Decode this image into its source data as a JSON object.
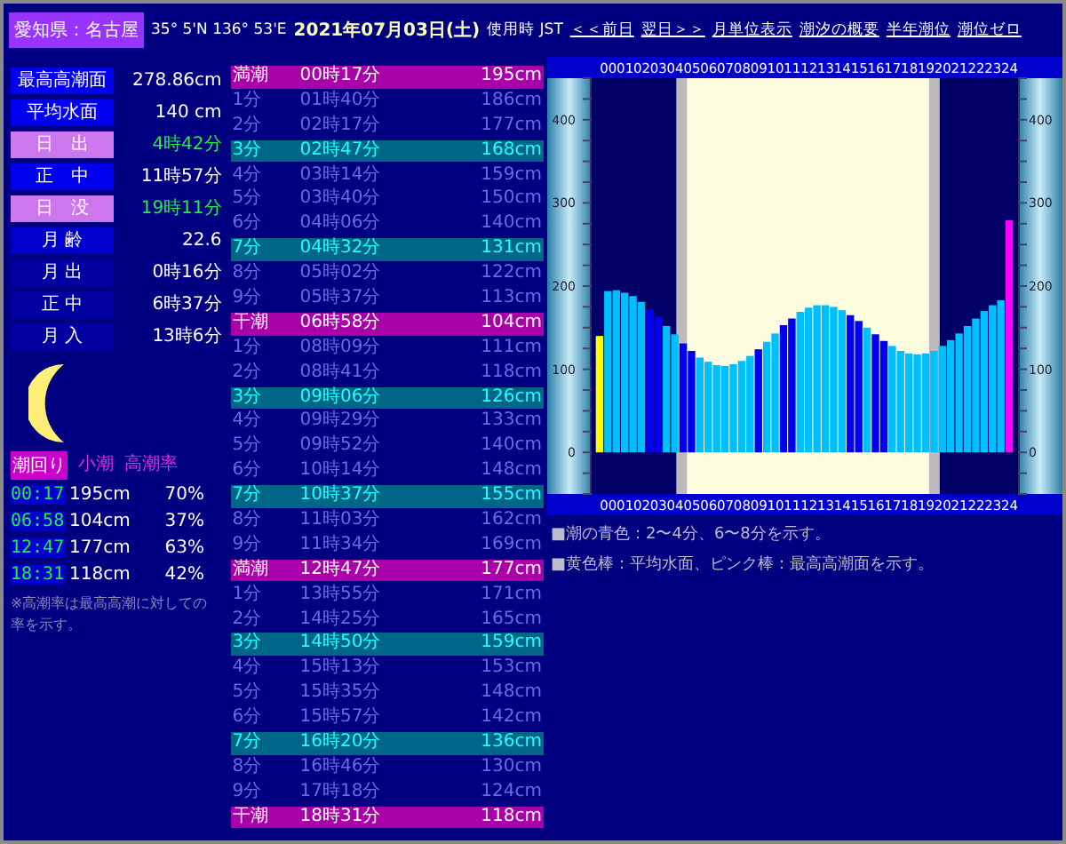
{
  "header": {
    "location": "愛知県：名古屋",
    "coords": "35° 5'N 136° 53'E",
    "date": "2021年07月03日(土)",
    "timezone": "使用時 JST",
    "links": [
      "＜＜前日",
      "翌日＞＞",
      "月単位表示",
      "潮汐の概要",
      "半年潮位",
      "潮位ゼロ"
    ]
  },
  "info": [
    {
      "kind": "tide",
      "label": "最高高潮面",
      "value": "278.86cm"
    },
    {
      "kind": "tide",
      "label": "平均水面",
      "value": "140 cm"
    },
    {
      "kind": "sun",
      "label": "日　出",
      "value": "4時42分"
    },
    {
      "kind": "tide",
      "label": "正　中",
      "value": "11時57分"
    },
    {
      "kind": "sun",
      "label": "日　没",
      "value": "19時11分"
    },
    {
      "kind": "age",
      "label": "月 齢",
      "value": "22.6"
    },
    {
      "kind": "moon",
      "label": "月 出",
      "value": "0時16分"
    },
    {
      "kind": "moon",
      "label": "正 中",
      "value": "6時37分"
    },
    {
      "kind": "moon",
      "label": "月 入",
      "value": "13時6分"
    }
  ],
  "summary": {
    "headers": [
      "潮回り",
      "小潮",
      "高潮率"
    ],
    "rows": [
      {
        "time": "00:17",
        "height": "195cm",
        "rate": "70%"
      },
      {
        "time": "06:58",
        "height": "104cm",
        "rate": "37%"
      },
      {
        "time": "12:47",
        "height": "177cm",
        "rate": "63%"
      },
      {
        "time": "18:31",
        "height": "118cm",
        "rate": "42%"
      }
    ],
    "note": "※高潮率は最高高潮に対しての率を示す。"
  },
  "tide_table": [
    {
      "kind": "peak",
      "label": "満潮",
      "time": "00時17分",
      "height": "195cm"
    },
    {
      "kind": "plain",
      "label": "1分",
      "time": "01時40分",
      "height": "186cm"
    },
    {
      "kind": "plain",
      "label": "2分",
      "time": "02時17分",
      "height": "177cm"
    },
    {
      "kind": "mark",
      "label": "3分",
      "time": "02時47分",
      "height": "168cm"
    },
    {
      "kind": "plain",
      "label": "4分",
      "time": "03時14分",
      "height": "159cm"
    },
    {
      "kind": "plain",
      "label": "5分",
      "time": "03時40分",
      "height": "150cm"
    },
    {
      "kind": "plain",
      "label": "6分",
      "time": "04時06分",
      "height": "140cm"
    },
    {
      "kind": "mark",
      "label": "7分",
      "time": "04時32分",
      "height": "131cm"
    },
    {
      "kind": "plain",
      "label": "8分",
      "time": "05時02分",
      "height": "122cm"
    },
    {
      "kind": "plain",
      "label": "9分",
      "time": "05時37分",
      "height": "113cm"
    },
    {
      "kind": "peak",
      "label": "干潮",
      "time": "06時58分",
      "height": "104cm"
    },
    {
      "kind": "plain",
      "label": "1分",
      "time": "08時09分",
      "height": "111cm"
    },
    {
      "kind": "plain",
      "label": "2分",
      "time": "08時41分",
      "height": "118cm"
    },
    {
      "kind": "mark",
      "label": "3分",
      "time": "09時06分",
      "height": "126cm"
    },
    {
      "kind": "plain",
      "label": "4分",
      "time": "09時29分",
      "height": "133cm"
    },
    {
      "kind": "plain",
      "label": "5分",
      "time": "09時52分",
      "height": "140cm"
    },
    {
      "kind": "plain",
      "label": "6分",
      "time": "10時14分",
      "height": "148cm"
    },
    {
      "kind": "mark",
      "label": "7分",
      "time": "10時37分",
      "height": "155cm"
    },
    {
      "kind": "plain",
      "label": "8分",
      "time": "11時03分",
      "height": "162cm"
    },
    {
      "kind": "plain",
      "label": "9分",
      "time": "11時34分",
      "height": "169cm"
    },
    {
      "kind": "peak",
      "label": "満潮",
      "time": "12時47分",
      "height": "177cm"
    },
    {
      "kind": "plain",
      "label": "1分",
      "time": "13時55分",
      "height": "171cm"
    },
    {
      "kind": "plain",
      "label": "2分",
      "time": "14時25分",
      "height": "165cm"
    },
    {
      "kind": "mark",
      "label": "3分",
      "time": "14時50分",
      "height": "159cm"
    },
    {
      "kind": "plain",
      "label": "4分",
      "time": "15時13分",
      "height": "153cm"
    },
    {
      "kind": "plain",
      "label": "5分",
      "time": "15時35分",
      "height": "148cm"
    },
    {
      "kind": "plain",
      "label": "6分",
      "time": "15時57分",
      "height": "142cm"
    },
    {
      "kind": "mark",
      "label": "7分",
      "time": "16時20分",
      "height": "136cm"
    },
    {
      "kind": "plain",
      "label": "8分",
      "time": "16時46分",
      "height": "130cm"
    },
    {
      "kind": "plain",
      "label": "9分",
      "time": "17時18分",
      "height": "124cm"
    },
    {
      "kind": "peak",
      "label": "干潮",
      "time": "18時31分",
      "height": "118cm"
    }
  ],
  "graph": {
    "chart_data": {
      "type": "bar",
      "ylim": [
        -50,
        450
      ],
      "yticks": [
        0,
        100,
        200,
        300,
        400
      ],
      "xlim": [
        -1,
        24.5
      ],
      "xticks": [
        {
          "value": 0,
          "label": "00"
        },
        {
          "value": 1,
          "label": "01"
        },
        {
          "value": 2,
          "label": "02"
        },
        {
          "value": 3,
          "label": "03"
        },
        {
          "value": 4,
          "label": "04"
        },
        {
          "value": 5,
          "label": "05"
        },
        {
          "value": 6,
          "label": "06"
        },
        {
          "value": 7,
          "label": "07"
        },
        {
          "value": 8,
          "label": "08"
        },
        {
          "value": 9,
          "label": "09"
        },
        {
          "value": 10,
          "label": "10"
        },
        {
          "value": 11,
          "label": "11"
        },
        {
          "value": 12,
          "label": "12"
        },
        {
          "value": 13,
          "label": "13"
        },
        {
          "value": 14,
          "label": "14"
        },
        {
          "value": 15,
          "label": "15"
        },
        {
          "value": 16,
          "label": "16"
        },
        {
          "value": 17,
          "label": "17"
        },
        {
          "value": 18,
          "label": "18"
        },
        {
          "value": 19,
          "label": "19"
        },
        {
          "value": 20,
          "label": "20"
        },
        {
          "value": 21,
          "label": "21"
        },
        {
          "value": 22,
          "label": "22"
        },
        {
          "value": 23,
          "label": "23"
        },
        {
          "value": 24,
          "label": "24"
        }
      ],
      "x": [
        -0.5,
        0,
        0.5,
        1,
        1.5,
        2,
        2.5,
        3,
        3.5,
        4,
        4.5,
        5,
        5.5,
        6,
        6.5,
        7,
        7.5,
        8,
        8.5,
        9,
        9.5,
        10,
        10.5,
        11,
        11.5,
        12,
        12.5,
        13,
        13.5,
        14,
        14.5,
        15,
        15.5,
        16,
        16.5,
        17,
        17.5,
        18,
        18.5,
        19,
        19.5,
        20,
        20.5,
        21,
        21.5,
        22,
        22.5,
        23,
        23.5,
        24
      ],
      "series": [
        {
          "color": "#ffff00",
          "values": [
            140,
            null,
            null,
            null,
            null,
            null,
            null,
            null,
            null,
            null,
            null,
            null,
            null,
            null,
            null,
            null,
            null,
            null,
            null,
            null,
            null,
            null,
            null,
            null,
            null,
            null,
            null,
            null,
            null,
            null,
            null,
            null,
            null,
            null,
            null,
            null,
            null,
            null,
            null,
            null,
            null,
            null,
            null,
            null,
            null,
            null,
            null,
            null,
            null,
            null
          ]
        },
        {
          "color": "#00bfff",
          "values": [
            null,
            194,
            195,
            192,
            188,
            181,
            null,
            null,
            152,
            142,
            null,
            null,
            114,
            109,
            105,
            104,
            106,
            110,
            116,
            null,
            133,
            143,
            null,
            null,
            169,
            174,
            177,
            177,
            175,
            171,
            null,
            null,
            150,
            null,
            null,
            128,
            122,
            119,
            118,
            119,
            122,
            128,
            135,
            143,
            152,
            161,
            170,
            177,
            183,
            null
          ]
        },
        {
          "color": "#0000ee",
          "values": [
            null,
            null,
            null,
            null,
            null,
            null,
            172,
            163,
            null,
            null,
            131,
            122,
            null,
            null,
            null,
            null,
            null,
            null,
            null,
            124,
            null,
            null,
            153,
            161,
            null,
            null,
            null,
            null,
            null,
            null,
            165,
            158,
            null,
            142,
            134,
            null,
            null,
            null,
            null,
            null,
            null,
            null,
            null,
            null,
            null,
            null,
            null,
            null,
            null,
            null
          ]
        },
        {
          "color": "#ff00ff",
          "values": [
            null,
            null,
            null,
            null,
            null,
            null,
            null,
            null,
            null,
            null,
            null,
            null,
            null,
            null,
            null,
            null,
            null,
            null,
            null,
            null,
            null,
            null,
            null,
            null,
            null,
            null,
            null,
            null,
            null,
            null,
            null,
            null,
            null,
            null,
            null,
            null,
            null,
            null,
            null,
            null,
            null,
            null,
            null,
            null,
            null,
            null,
            null,
            null,
            null,
            279
          ]
        }
      ]
    },
    "left_axis_labels": [
      "400",
      "300",
      "200",
      "100",
      "0"
    ],
    "notes": [
      "■潮の青色：2〜4分、6〜8分を示す。",
      "■黄色棒：平均水面、ピンク棒：最高高潮面を示す。"
    ]
  }
}
